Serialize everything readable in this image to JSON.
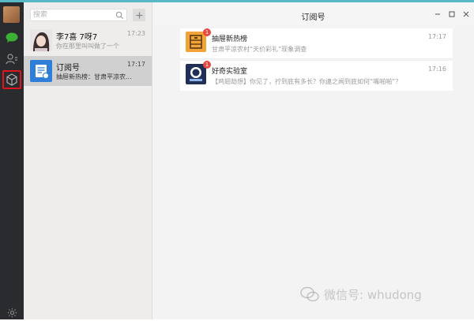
{
  "window": {
    "title": "订阅号"
  },
  "search": {
    "placeholder": "搜索"
  },
  "rail": {
    "icons": [
      "avatar",
      "chat-icon",
      "contacts-icon",
      "subscriptions-icon",
      "settings-icon"
    ]
  },
  "chats": [
    {
      "name": "李7喜 7呀7",
      "time": "17:23",
      "preview": "你在那里叫叫做了一个"
    },
    {
      "name": "订阅号",
      "time": "17:17",
      "preview": "抽屉新热榜：甘肃平凉农..."
    }
  ],
  "subscriptions": [
    {
      "name": "抽屉新热榜",
      "time": "17:17",
      "badge": "1",
      "message": "甘肃平凉农村“天价彩礼”现象调查"
    },
    {
      "name": "好奇实验室",
      "time": "17:16",
      "badge": "1",
      "message": "【鸡翅劫想】你见了，拧到底有多长？你逮之闻到底如何“嘴啪啪”？"
    }
  ],
  "watermark": {
    "text": "微信号: whudong"
  },
  "colors": {
    "rail": "#2a2b2e",
    "accent_red": "#e0141d",
    "chat_green": "#3cb034",
    "badge": "#e8473f"
  }
}
